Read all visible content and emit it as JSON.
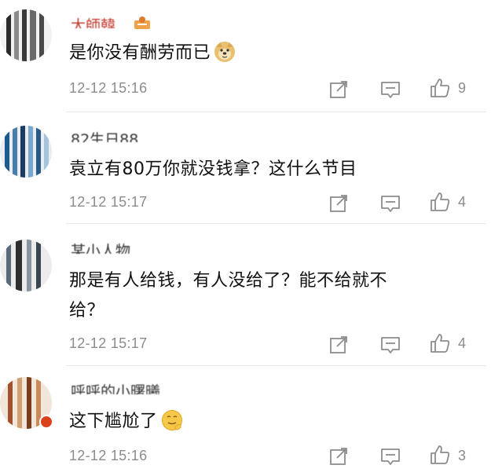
{
  "comments": [
    {
      "username": "大師韓",
      "text": "是你没有酬劳而已",
      "emoji": "doge-emoji",
      "timestamp": "12-12 15:16",
      "likes": "9"
    },
    {
      "username": "82生日88",
      "text": "袁立有80万你就没钱拿？这什么节目",
      "timestamp": "12-12 15:17",
      "likes": "4"
    },
    {
      "username": "某小人物",
      "text_line1": "那是有人给钱，有人没给了？能不给就不",
      "text_line2": "给？",
      "timestamp": "12-12 15:17",
      "likes": "4"
    },
    {
      "username": "呼呼的小曙曦",
      "text": "这下尴尬了",
      "emoji": "awkward-smile-emoji",
      "timestamp": "12-12 15:16",
      "likes": "3"
    }
  ],
  "icons": {
    "share": "share-icon",
    "comment": "comment-icon",
    "like": "thumbs-up-icon"
  },
  "colors": {
    "text": "#111111",
    "meta": "#8c8c8c",
    "divider": "#e8e8e8",
    "emoji_yellow": "#f5c84a"
  }
}
